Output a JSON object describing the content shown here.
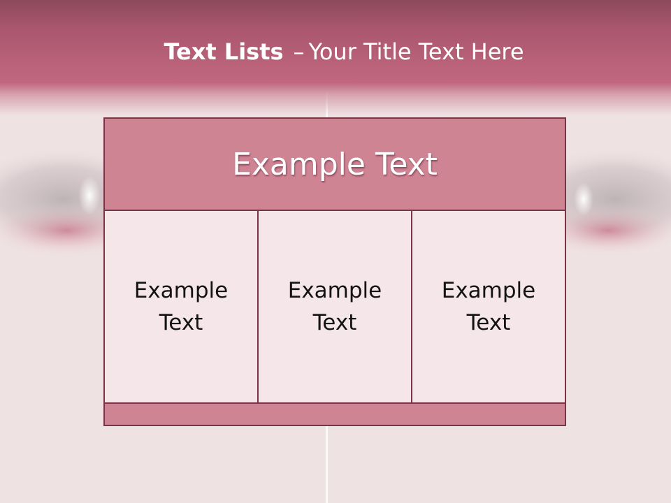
{
  "slide": {
    "title": {
      "bold": "Text Lists",
      "dash": "–",
      "rest": "Your Title Text Here"
    },
    "header_box": {
      "text": "Example Text"
    },
    "cells": [
      {
        "text": "Example Text"
      },
      {
        "text": "Example Text"
      },
      {
        "text": "Example Text"
      }
    ],
    "colors": {
      "accent": "#c0677f",
      "box_fill": "#cf8494",
      "cell_fill": "#f4e6e9",
      "border": "#7a3448"
    }
  }
}
